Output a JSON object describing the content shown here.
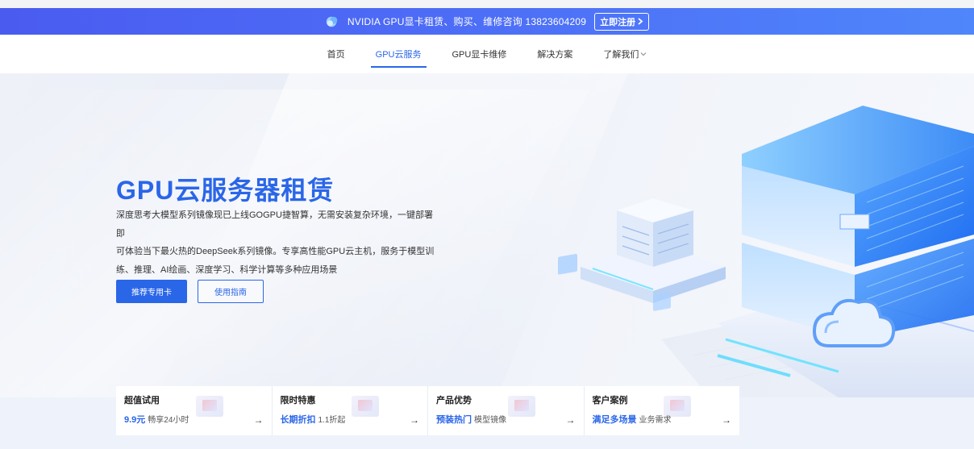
{
  "promo": {
    "text": "NVIDIA GPU显卡租赁、购买、维修咨询 13823604209",
    "register_label": "立即注册",
    "logo_icon": "cloud-logo-icon",
    "chevron_icon": "chevron-right-icon"
  },
  "nav": {
    "items": [
      {
        "label": "首页"
      },
      {
        "label": "GPU云服务"
      },
      {
        "label": "GPU显卡维修"
      },
      {
        "label": "解决方案"
      },
      {
        "label": "了解我们"
      }
    ],
    "active_index": 1
  },
  "hero": {
    "title": "GPU云服务器租赁",
    "desc_lines": [
      "深度思考大模型系列镜像现已上线GOGPU捷智算，无需安装复杂环境，一键部署即",
      "可体验当下最火热的DeepSeek系列镜像。专享高性能GPU云主机，服务于模型训",
      "练、推理、AI绘画、深度学习、科学计算等多种应用场景"
    ],
    "primary_button": "推荐专用卡",
    "secondary_button": "使用指南"
  },
  "cards": [
    {
      "title": "超值试用",
      "highlight": "9.9元",
      "subtext": "畅享24小时"
    },
    {
      "title": "限时特惠",
      "highlight": "长期折扣",
      "subtext": "1.1折起"
    },
    {
      "title": "产品优势",
      "highlight": "预装热门",
      "subtext": "模型镜像"
    },
    {
      "title": "客户案例",
      "highlight": "满足多场景",
      "subtext": "业务需求"
    }
  ],
  "colors": {
    "accent": "#2a66e8",
    "promo_start": "#4a5cf0",
    "promo_end": "#4f86fb"
  }
}
